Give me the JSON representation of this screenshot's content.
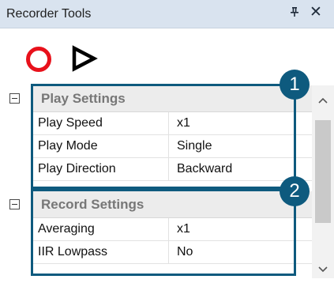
{
  "window": {
    "title": "Recorder Tools",
    "pin_glyph": "Ȩ",
    "close_glyph": "✕"
  },
  "toolbar": {
    "record_icon": "record-circle",
    "record_color": "#e8111b",
    "play_icon": "play-triangle"
  },
  "groups": [
    {
      "title": "Play Settings",
      "properties": [
        {
          "name": "Play Speed",
          "value": "x1"
        },
        {
          "name": "Play Mode",
          "value": "Single"
        },
        {
          "name": "Play Direction",
          "value": "Backward"
        }
      ]
    },
    {
      "title": "Record Settings",
      "properties": [
        {
          "name": "Averaging",
          "value": "x1"
        },
        {
          "name": "IIR Lowpass",
          "value": "No"
        }
      ]
    }
  ],
  "callouts": {
    "one": "1",
    "two": "2",
    "color": "#0e5a7e"
  }
}
